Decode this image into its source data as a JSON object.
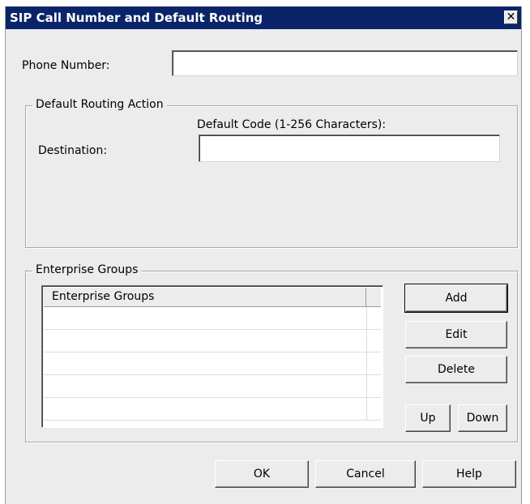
{
  "window": {
    "title": "SIP Call Number and Default Routing",
    "close_glyph": "✕"
  },
  "phone": {
    "label": "Phone Number:",
    "value": ""
  },
  "routing": {
    "group_title": "Default Routing Action",
    "code_label": "Default Code (1-256 Characters):",
    "destination_label": "Destination:",
    "code_value": ""
  },
  "enterprise": {
    "group_title": "Enterprise Groups",
    "column_header": "Enterprise Groups",
    "rows": [
      "",
      "",
      "",
      "",
      ""
    ],
    "buttons": {
      "add": "Add",
      "edit": "Edit",
      "delete": "Delete",
      "up": "Up",
      "down": "Down"
    }
  },
  "footer": {
    "ok": "OK",
    "cancel": "Cancel",
    "help": "Help"
  }
}
